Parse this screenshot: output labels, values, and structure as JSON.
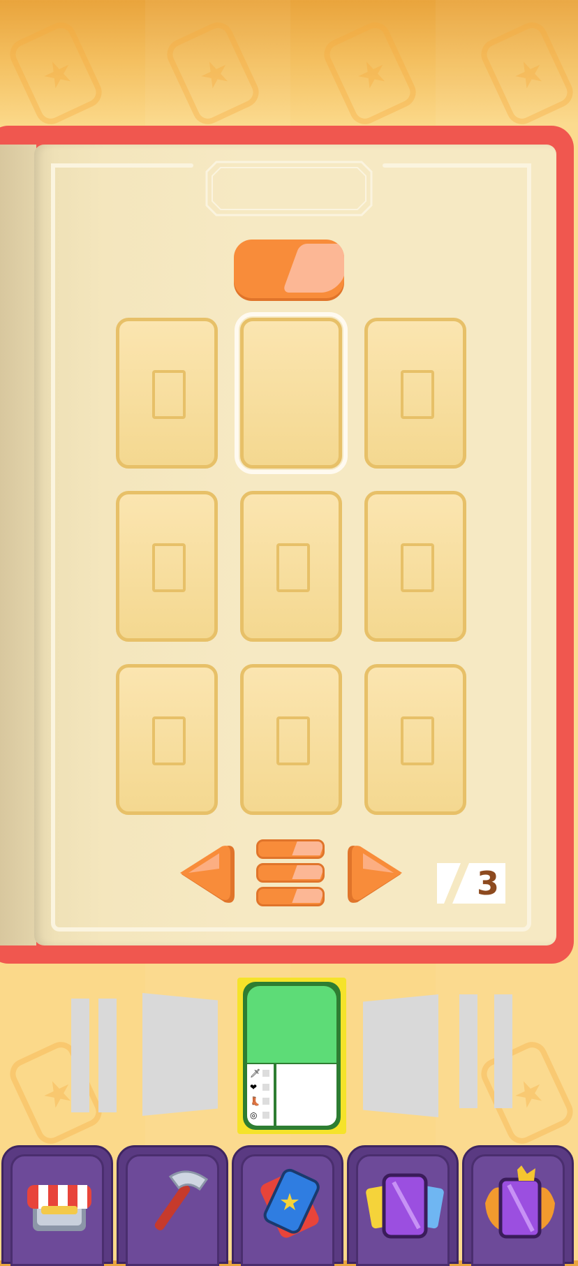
{
  "album": {
    "page_total": "3",
    "slots": [
      {
        "id": "slot-1",
        "state": "empty"
      },
      {
        "id": "slot-2",
        "state": "selected"
      },
      {
        "id": "slot-3",
        "state": "empty"
      },
      {
        "id": "slot-4",
        "state": "empty"
      },
      {
        "id": "slot-5",
        "state": "empty"
      },
      {
        "id": "slot-6",
        "state": "empty"
      },
      {
        "id": "slot-7",
        "state": "empty"
      },
      {
        "id": "slot-8",
        "state": "empty"
      },
      {
        "id": "slot-9",
        "state": "empty"
      }
    ]
  },
  "featured_card": {
    "stat_icons": [
      "sword-icon",
      "heart-icon",
      "boot-icon",
      "target-icon"
    ]
  },
  "bottom_nav": {
    "items": [
      {
        "name": "shop",
        "icon": "shop-icon"
      },
      {
        "name": "craft",
        "icon": "hammer-icon"
      },
      {
        "name": "cards",
        "icon": "star-card-icon"
      },
      {
        "name": "packs",
        "icon": "card-pack-icon"
      },
      {
        "name": "premium",
        "icon": "crowned-pack-icon"
      }
    ]
  },
  "colors": {
    "accent_orange": "#f88c3a",
    "book_red": "#f0574f",
    "nav_purple": "#5a3a82",
    "card_green": "#5ddc77"
  }
}
